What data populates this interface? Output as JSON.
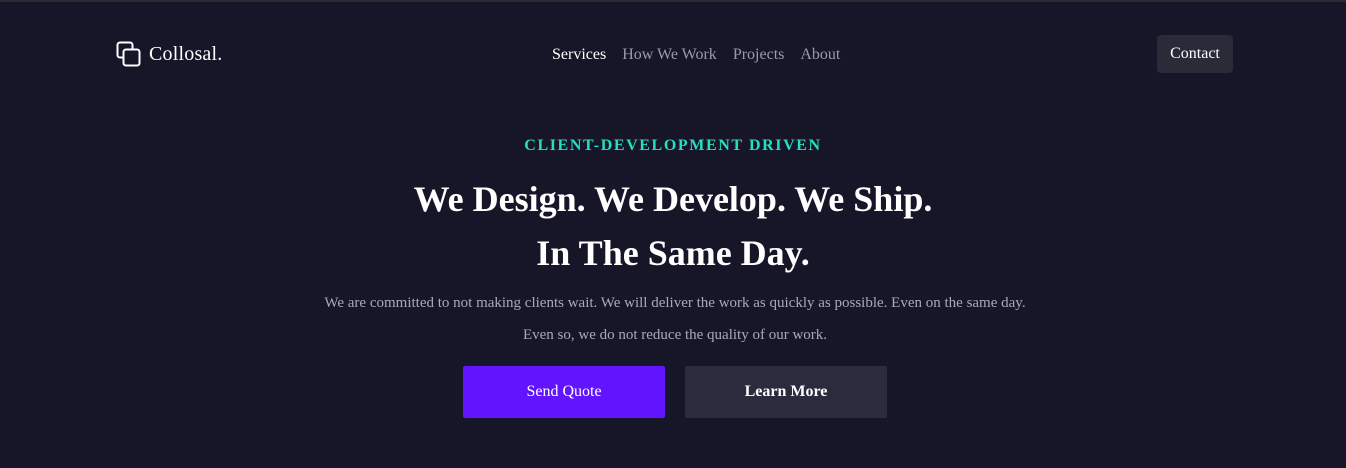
{
  "navbar": {
    "brand": {
      "name": "Collosal.",
      "icon": "stacked-squares-icon"
    },
    "links": [
      {
        "label": "Services",
        "active": true
      },
      {
        "label": "How We Work",
        "active": false
      },
      {
        "label": "Projects",
        "active": false
      },
      {
        "label": "About",
        "active": false
      }
    ],
    "contact_label": "Contact"
  },
  "hero": {
    "eyebrow": "CLIENT-DEVELOPMENT DRIVEN",
    "headline_line1": "We Design. We Develop. We Ship.",
    "headline_line2": "In The Same Day.",
    "description": "We are committed to not making clients wait. We will deliver the work as quickly as possible. Even on the same day. Even so, we do not reduce the quality of our work.",
    "primary_cta": "Send Quote",
    "secondary_cta": "Learn More"
  },
  "colors": {
    "background": "#161628",
    "accent": "#22e0c0",
    "primary_button": "#6214ff",
    "secondary_button": "#2b2b3d",
    "nav_inactive": "#9a9aa8",
    "text": "#ffffff"
  }
}
